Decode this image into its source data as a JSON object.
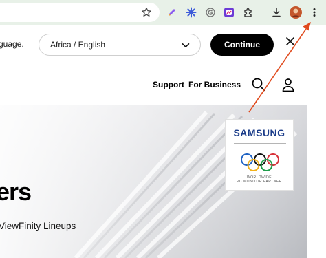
{
  "browser": {
    "icons": [
      "star-icon",
      "pen-icon",
      "sparkle-icon",
      "grammarly-icon",
      "colorful-extension-icon",
      "puzzle-icon",
      "download-icon",
      "avatar",
      "more-vert-icon"
    ]
  },
  "region_bar": {
    "message": "guage.",
    "region_value": "Africa / English",
    "continue_label": "Continue"
  },
  "header": {
    "support_label": "Support",
    "business_label": "For Business"
  },
  "hero": {
    "heading": "ers",
    "subheading": "ViewFinity Lineups",
    "partner": {
      "brand": "SAMSUNG",
      "line1": "WORLDWIDE",
      "line2": "PC MONITOR PARTNER"
    }
  },
  "colors": {
    "toolbar_bg": "#e8f1e8",
    "annotation": "#e0491c",
    "continue_bg": "#000000",
    "brand_blue": "#1c3d8a"
  }
}
